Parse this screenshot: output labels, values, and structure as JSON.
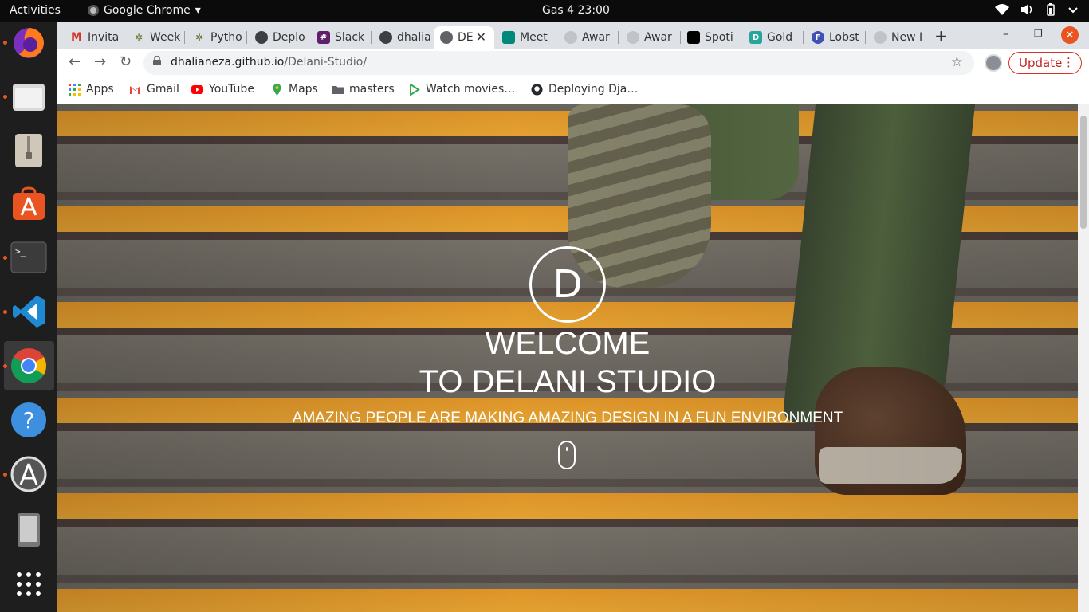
{
  "system_bar": {
    "activities": "Activities",
    "app_name": "Google Chrome",
    "app_arrow": "▾",
    "clock": "Gas 4  23:00",
    "tray": [
      "wifi-icon",
      "volume-icon",
      "battery-icon",
      "power-menu-icon"
    ]
  },
  "dock": {
    "items": [
      "firefox-icon",
      "files-icon",
      "archive-manager-icon",
      "software-icon",
      "terminal-icon",
      "vscode-icon",
      "chrome-icon",
      "help-icon",
      "software-updater-icon",
      "device-icon",
      "show-apps-icon"
    ],
    "active": "chrome-icon"
  },
  "tabs": [
    {
      "label": "Invita",
      "favicon": "gmail-icon",
      "color": "#d93025"
    },
    {
      "label": "Week",
      "favicon": "moringa-icon",
      "color": "#6a7d3a"
    },
    {
      "label": "Pytho",
      "favicon": "moringa-icon",
      "color": "#6a7d3a"
    },
    {
      "label": "Deplo",
      "favicon": "github-icon",
      "color": "#24292e"
    },
    {
      "label": "Slack",
      "favicon": "slack-icon",
      "color": "#611f69"
    },
    {
      "label": "dhalia",
      "favicon": "github-icon",
      "color": "#24292e"
    },
    {
      "label": "DE",
      "favicon": "globe-icon",
      "color": "#5f6368",
      "active": true
    },
    {
      "label": "Meet",
      "favicon": "meet-icon",
      "color": "#00897b"
    },
    {
      "label": "Awar",
      "favicon": "globe-icon",
      "color": "#9aa0a6"
    },
    {
      "label": "Awar",
      "favicon": "globe-icon",
      "color": "#9aa0a6"
    },
    {
      "label": "Spoti",
      "favicon": "spotify-icon",
      "color": "#000000"
    },
    {
      "label": "Gold",
      "favicon": "d-icon",
      "color": "#26a69a"
    },
    {
      "label": "Lobst",
      "favicon": "f-icon",
      "color": "#3f51b5"
    },
    {
      "label": "New I",
      "favicon": "globe-icon",
      "color": "#9aa0a6"
    }
  ],
  "toolbar": {
    "url_host": "dhalianeza.github.io",
    "url_path": "/Delani-Studio/",
    "update_label": "Update"
  },
  "bookmarks": [
    {
      "label": "Apps",
      "icon": "apps-grid-icon"
    },
    {
      "label": "Gmail",
      "icon": "gmail-icon"
    },
    {
      "label": "YouTube",
      "icon": "youtube-icon"
    },
    {
      "label": "Maps",
      "icon": "maps-icon"
    },
    {
      "label": "masters",
      "icon": "folder-icon"
    },
    {
      "label": "Watch movies…",
      "icon": "play-icon"
    },
    {
      "label": "Deploying Dja…",
      "icon": "github-icon"
    }
  ],
  "page": {
    "logo_letter": "D",
    "welcome_line1": "WELCOME",
    "welcome_line2": "TO DELANI STUDIO",
    "tagline": "AMAZING PEOPLE ARE MAKING AMAZING DESIGN IN A FUN ENVIRONMENT"
  }
}
